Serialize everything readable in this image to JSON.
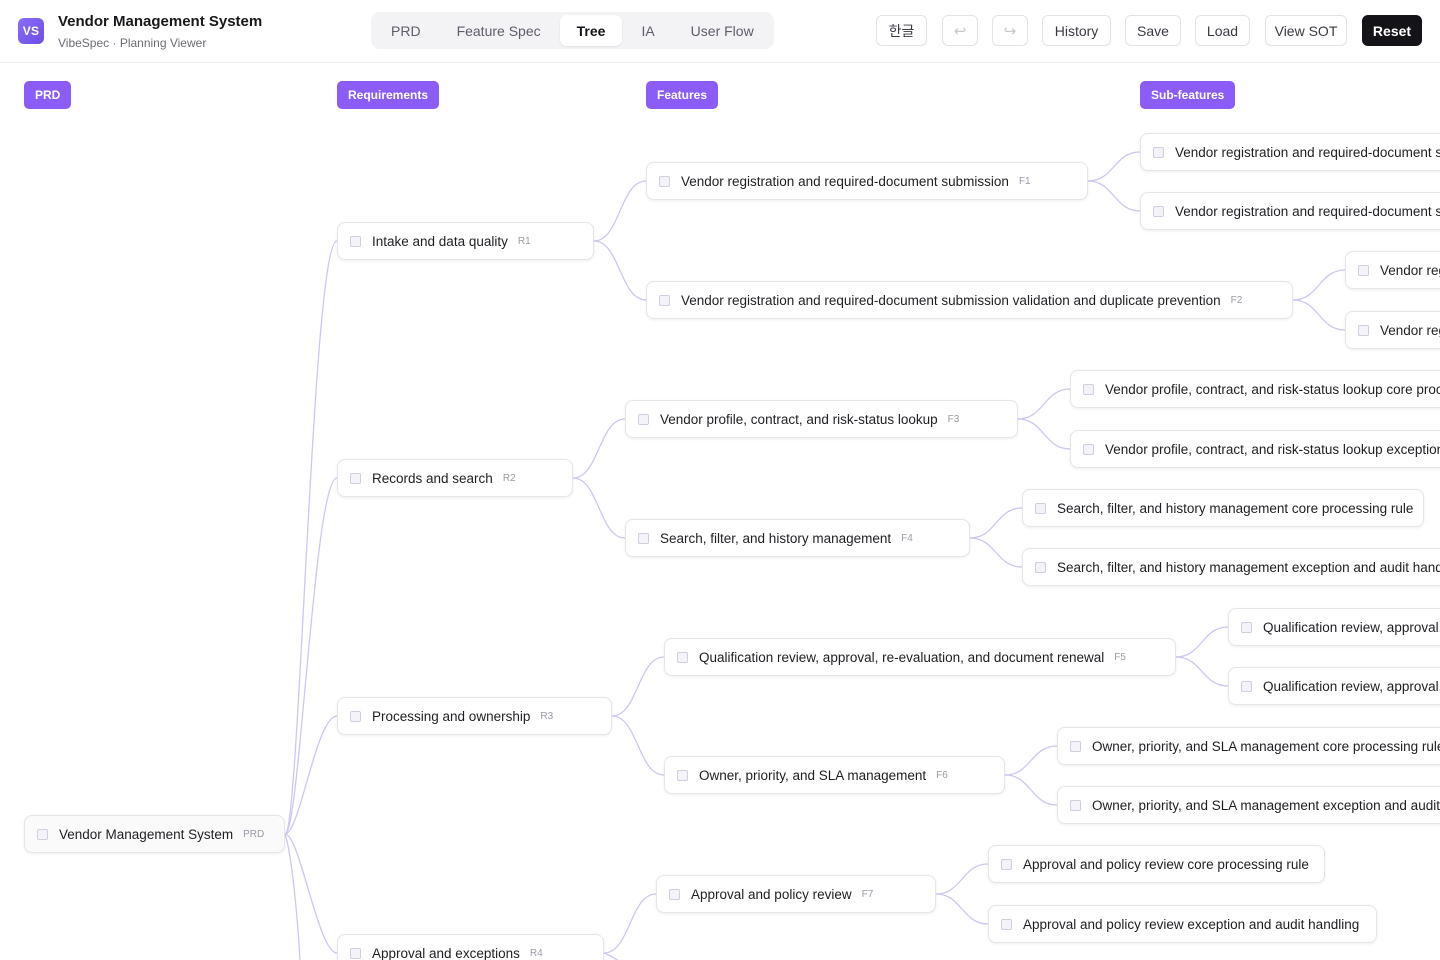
{
  "app": {
    "logo": "VS",
    "title": "Vendor Management System",
    "subtitle": "VibeSpec · Planning Viewer"
  },
  "tabs": [
    {
      "label": "PRD",
      "active": false
    },
    {
      "label": "Feature Spec",
      "active": false
    },
    {
      "label": "Tree",
      "active": true
    },
    {
      "label": "IA",
      "active": false
    },
    {
      "label": "User Flow",
      "active": false
    }
  ],
  "actions": {
    "language": "한글",
    "undo_icon": "undo-icon",
    "redo_icon": "redo-icon",
    "history": "History",
    "save": "Save",
    "load": "Load",
    "view_sot": "View SOT",
    "reset": "Reset"
  },
  "columns": {
    "prd": "PRD",
    "requirements": "Requirements",
    "features": "Features",
    "subfeatures": "Sub-features"
  },
  "root": {
    "label": "Vendor Management System",
    "code": "PRD"
  },
  "requirements": [
    {
      "label": "Intake and data quality",
      "code": "R1"
    },
    {
      "label": "Records and search",
      "code": "R2"
    },
    {
      "label": "Processing and ownership",
      "code": "R3"
    },
    {
      "label": "Approval and exceptions",
      "code": "R4"
    }
  ],
  "features": [
    {
      "label": "Vendor registration and required-document submission",
      "code": "F1"
    },
    {
      "label": "Vendor registration and required-document submission validation and duplicate prevention",
      "code": "F2"
    },
    {
      "label": "Vendor profile, contract, and risk-status lookup",
      "code": "F3"
    },
    {
      "label": "Search, filter, and history management",
      "code": "F4"
    },
    {
      "label": "Qualification review, approval, re-evaluation, and document renewal",
      "code": "F5"
    },
    {
      "label": "Owner, priority, and SLA management",
      "code": "F6"
    },
    {
      "label": "Approval and policy review",
      "code": "F7"
    }
  ],
  "subfeatures": [
    {
      "label": "Vendor registration and required-document submission core processing rule"
    },
    {
      "label": "Vendor registration and required-document submission exception and audit handling"
    },
    {
      "label": "Vendor registration and required-document submission validation and duplicate prevention core processing rule"
    },
    {
      "label": "Vendor registration and required-document submission validation and duplicate prevention exception and audit handling"
    },
    {
      "label": "Vendor profile, contract, and risk-status lookup core processing rule"
    },
    {
      "label": "Vendor profile, contract, and risk-status lookup exception and audit handling"
    },
    {
      "label": "Search, filter, and history management core processing rule"
    },
    {
      "label": "Search, filter, and history management exception and audit handling"
    },
    {
      "label": "Qualification review, approval, re-evaluation, and document renewal core processing rule"
    },
    {
      "label": "Qualification review, approval, re-evaluation, and document renewal exception and audit handling"
    },
    {
      "label": "Owner, priority, and SLA management core processing rule"
    },
    {
      "label": "Owner, priority, and SLA management exception and audit handling"
    },
    {
      "label": "Approval and policy review core processing rule"
    },
    {
      "label": "Approval and policy review exception and audit handling"
    }
  ]
}
